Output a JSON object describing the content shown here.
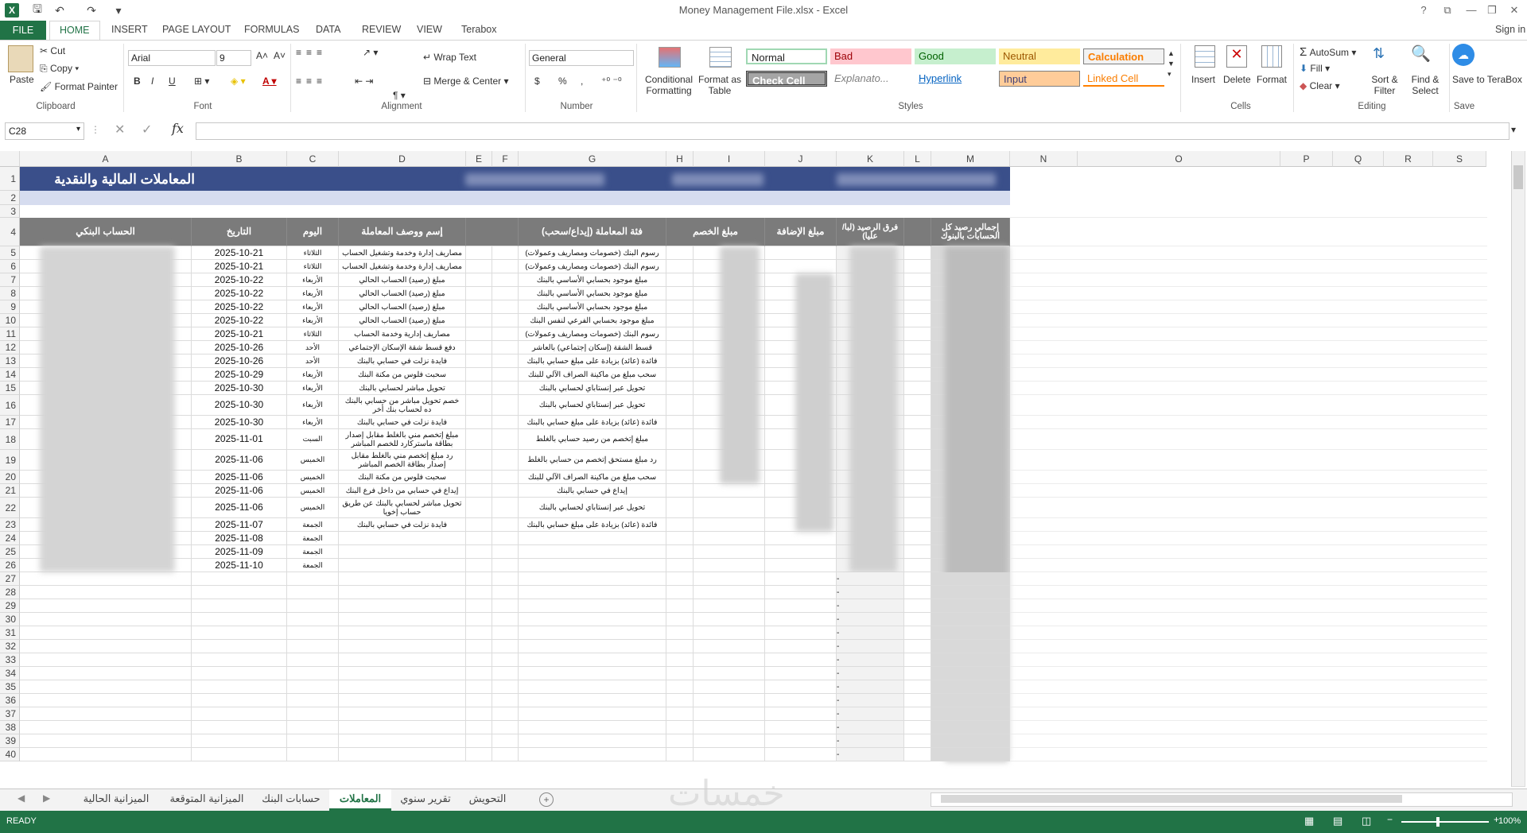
{
  "window": {
    "title": "Money Management File.xlsx - Excel",
    "signin": "Sign in"
  },
  "ribbon_tabs": [
    "FILE",
    "HOME",
    "INSERT",
    "PAGE LAYOUT",
    "FORMULAS",
    "DATA",
    "REVIEW",
    "VIEW",
    "Terabox"
  ],
  "clipboard": {
    "paste": "Paste",
    "cut": "Cut",
    "copy": "Copy",
    "format_painter": "Format Painter",
    "label": "Clipboard"
  },
  "font": {
    "name": "Arial",
    "size": "9",
    "bold": "B",
    "italic": "I",
    "underline": "U",
    "label": "Font"
  },
  "alignment": {
    "wrap": "Wrap Text",
    "merge": "Merge & Center",
    "label": "Alignment"
  },
  "number": {
    "format": "General",
    "currency": "$",
    "percent": "%",
    "comma": ",",
    "label": "Number"
  },
  "styles": {
    "conditional": "Conditional Formatting",
    "format_table": "Format as Table",
    "normal": "Normal",
    "bad": "Bad",
    "good": "Good",
    "neutral": "Neutral",
    "calculation": "Calculation",
    "check_cell": "Check Cell",
    "explanatory": "Explanato...",
    "hyperlink": "Hyperlink",
    "input": "Input",
    "linked_cell": "Linked Cell",
    "label": "Styles"
  },
  "cells": {
    "insert": "Insert",
    "delete": "Delete",
    "format": "Format",
    "label": "Cells"
  },
  "editing": {
    "autosum": "AutoSum",
    "fill": "Fill",
    "clear": "Clear",
    "sort": "Sort & Filter",
    "find": "Find & Select",
    "label": "Editing"
  },
  "save": {
    "save_terabox": "Save to TeraBox",
    "label": "Save"
  },
  "formula_bar": {
    "name_box": "C28",
    "fx": "fx",
    "value": ""
  },
  "columns": [
    "A",
    "B",
    "C",
    "D",
    "E",
    "F",
    "G",
    "H",
    "I",
    "J",
    "K",
    "L",
    "M",
    "N",
    "O",
    "P",
    "Q",
    "R",
    "S"
  ],
  "sheet_title": "المعاملات المالية والنقدية",
  "headers": {
    "bank_account": "الحساب البنكي",
    "date": "التاريخ",
    "day": "اليوم",
    "desc": "إسم ووصف المعاملة",
    "category": "فئة المعاملة (إيداع/سحب)",
    "debit": "مبلغ الخصم",
    "credit": "مبلغ الإضافة",
    "diff": "فرق الرصيد (لبا/عليا)",
    "total": "إجمالي رصيد كل الحسابات بالبنوك"
  },
  "rows": [
    {
      "n": "5",
      "date": "2025-10-21",
      "day": "الثلاثاء",
      "desc": "مصاريف إدارة وخدمة وتشغيل الحساب",
      "cat": "رسوم البنك (خصومات ومصاريف وعمولات)"
    },
    {
      "n": "6",
      "date": "2025-10-21",
      "day": "الثلاثاء",
      "desc": "مصاريف إدارة وخدمة وتشغيل الحساب",
      "cat": "رسوم البنك (خصومات ومصاريف وعمولات)"
    },
    {
      "n": "7",
      "date": "2025-10-22",
      "day": "الأربعاء",
      "desc": "مبلغ (رصيد) الحساب الحالي",
      "cat": "مبلغ موجود بحسابي الأساسي بالبنك"
    },
    {
      "n": "8",
      "date": "2025-10-22",
      "day": "الأربعاء",
      "desc": "مبلغ (رصيد) الحساب الحالي",
      "cat": "مبلغ موجود بحسابي الأساسي بالبنك"
    },
    {
      "n": "9",
      "date": "2025-10-22",
      "day": "الأربعاء",
      "desc": "مبلغ (رصيد) الحساب الحالي",
      "cat": "مبلغ موجود بحسابي الأساسي بالبنك"
    },
    {
      "n": "10",
      "date": "2025-10-22",
      "day": "الأربعاء",
      "desc": "مبلغ (رصيد) الحساب الحالي",
      "cat": "مبلغ موجود بحسابي الفرعي لنفس البنك"
    },
    {
      "n": "11",
      "date": "2025-10-21",
      "day": "الثلاثاء",
      "desc": "مصاريف إدارية وخدمة الحساب",
      "cat": "رسوم البنك (خصومات ومصاريف وعمولات)"
    },
    {
      "n": "12",
      "date": "2025-10-26",
      "day": "الأحد",
      "desc": "دفع قسط شقة الإسكان الإجتماعي",
      "cat": "قسط الشقة (إسكان إجتماعي) بالعاشر"
    },
    {
      "n": "13",
      "date": "2025-10-26",
      "day": "الأحد",
      "desc": "فايدة نزلت في حسابي بالبنك",
      "cat": "فائدة (عائد) بزيادة على مبلغ حسابي بالبنك"
    },
    {
      "n": "14",
      "date": "2025-10-29",
      "day": "الأربعاء",
      "desc": "سحبت فلوس من مكنة البنك",
      "cat": "سحب مبلغ من ماكينة الصراف الآلي للبنك"
    },
    {
      "n": "15",
      "date": "2025-10-30",
      "day": "الأربعاء",
      "desc": "تحويل مباشر لحسابي بالبنك",
      "cat": "تحويل عبر إنستاباي لحسابي بالبنك"
    },
    {
      "n": "16",
      "date": "2025-10-30",
      "day": "الأربعاء",
      "desc": "خصم تحويل مباشر من حسابي بالبنك ده لحساب بنك أخر",
      "cat": "تحويل عبر إنستاباي لحسابي بالبنك"
    },
    {
      "n": "17",
      "date": "2025-10-30",
      "day": "الأربعاء",
      "desc": "فايدة نزلت في حسابي بالبنك",
      "cat": "فائدة (عائد) بزيادة على مبلغ حسابي بالبنك"
    },
    {
      "n": "18",
      "date": "2025-11-01",
      "day": "السبت",
      "desc": "مبلغ إتخصم مني بالغلط مقابل إصدار بطاقة ماستركارد للخصم المباشر",
      "cat": "مبلغ إتخصم من رصيد حسابي بالغلط"
    },
    {
      "n": "19",
      "date": "2025-11-06",
      "day": "الخميس",
      "desc": "رد مبلغ إتخصم مني بالغلط مقابل إصدار بطاقة الخصم المباشر",
      "cat": "رد مبلغ مستحق إتخصم من حسابي بالغلط"
    },
    {
      "n": "20",
      "date": "2025-11-06",
      "day": "الخميس",
      "desc": "سحبت فلوس من مكنة البنك",
      "cat": "سحب مبلغ من ماكينة الصراف الآلي للبنك"
    },
    {
      "n": "21",
      "date": "2025-11-06",
      "day": "الخميس",
      "desc": "إيداع في حسابي من داخل فرع البنك",
      "cat": "إيداع في حسابي بالبنك"
    },
    {
      "n": "22",
      "date": "2025-11-06",
      "day": "الخميس",
      "desc": "تحويل مباشر لحسابي بالبنك عن طريق حساب إخويا",
      "cat": "تحويل عبر إنستاباي لحسابي بالبنك"
    },
    {
      "n": "23",
      "date": "2025-11-07",
      "day": "الجمعة",
      "desc": "فايدة نزلت في حسابي بالبنك",
      "cat": "فائدة (عائد) بزيادة على مبلغ حسابي بالبنك"
    },
    {
      "n": "24",
      "date": "2025-11-08",
      "day": "الجمعة",
      "desc": "",
      "cat": ""
    },
    {
      "n": "25",
      "date": "2025-11-09",
      "day": "الجمعة",
      "desc": "",
      "cat": ""
    },
    {
      "n": "26",
      "date": "2025-11-10",
      "day": "الجمعة",
      "desc": "",
      "cat": ""
    }
  ],
  "empty_rows": [
    "27",
    "28",
    "29",
    "30",
    "31",
    "32",
    "33",
    "34",
    "35",
    "36",
    "37",
    "38",
    "39",
    "40"
  ],
  "dash": "-",
  "sheet_tabs": [
    "الميزانية الحالية",
    "الميزانية المتوقعة",
    "حسابات البنك",
    "المعاملات",
    "تقرير سنوي",
    "التحويش"
  ],
  "active_sheet": "المعاملات",
  "status": {
    "ready": "READY",
    "zoom": "100%"
  },
  "watermark": "خمسات"
}
